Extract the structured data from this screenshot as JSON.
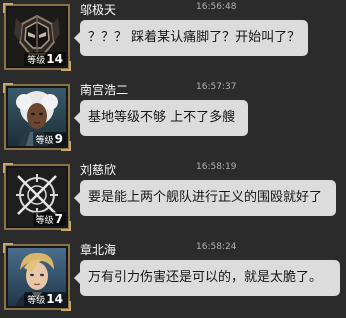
{
  "messages": [
    {
      "sender": "邬极天",
      "time": "16:56:48",
      "level_label": "等级",
      "level": "14",
      "text": "？？？ 踩着某认痛脚了？开始叫了？",
      "avatar_icon": "mech-helmet-icon"
    },
    {
      "sender": "南宫浩二",
      "time": "16:57:37",
      "level_label": "等级",
      "level": "9",
      "text": "基地等级不够 上不了多艘",
      "avatar_icon": "white-haired-woman-portrait"
    },
    {
      "sender": "刘慈欣",
      "time": "16:58:19",
      "level_label": "等级",
      "level": "7",
      "text": "要是能上两个舰队进行正义的围殴就好了",
      "avatar_icon": "crosshair-emblem-icon"
    },
    {
      "sender": "章北海",
      "time": "16:58:24",
      "level_label": "等级",
      "level": "14",
      "text": "万有引力伤害还是可以的，就是太脆了。",
      "avatar_icon": "blond-officer-portrait"
    }
  ]
}
